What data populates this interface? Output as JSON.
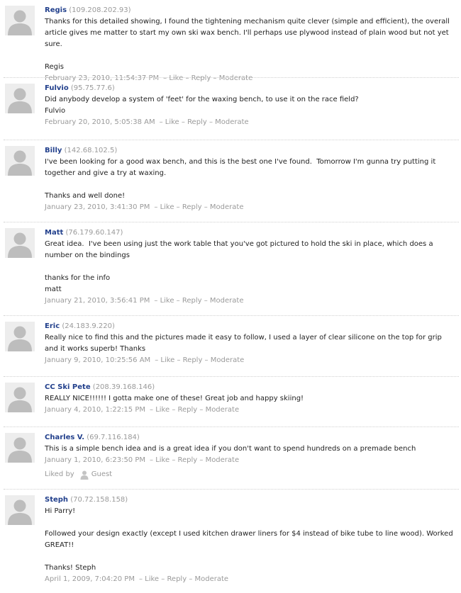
{
  "actions": {
    "like": "Like",
    "reply": "Reply",
    "moderate": "Moderate"
  },
  "liked_by": {
    "label": "Liked by",
    "user": "Guest"
  },
  "comments": [
    {
      "author": "Regis",
      "ip": "(109.208.202.93)",
      "text": "Thanks for this detailed showing, I found the tightening mechanism quite clever (simple and efficient), the overall article gives me matter to start my own ski wax bench. I'll perhaps use plywood instead of plain wood but not yet sure.\n\nRegis",
      "date": "February 23, 2010, 11:54:37 PM"
    },
    {
      "author": "Fulvio",
      "ip": "(95.75.77.6)",
      "text": "Did anybody develop a system of 'feet' for the waxing bench, to use it on the race field?\nFulvio",
      "date": "February 20, 2010, 5:05:38 AM"
    },
    {
      "author": "Billy",
      "ip": "(142.68.102.5)",
      "text": "I've been looking for a good wax bench, and this is the best one I've found.  Tomorrow I'm gunna try putting it together and give a try at waxing.\n\nThanks and well done!",
      "date": "January 23, 2010, 3:41:30 PM"
    },
    {
      "author": "Matt",
      "ip": "(76.179.60.147)",
      "text": "Great idea.  I've been using just the work table that you've got pictured to hold the ski in place, which does a number on the bindings\n\nthanks for the info\nmatt",
      "date": "January 21, 2010, 3:56:41 PM"
    },
    {
      "author": "Eric",
      "ip": "(24.183.9.220)",
      "text": "Really nice to find this and the pictures made it easy to follow, I used a layer of clear silicone on the top for grip and it works superb! Thanks",
      "date": "January 9, 2010, 10:25:56 AM"
    },
    {
      "author": "CC Ski Pete",
      "ip": "(208.39.168.146)",
      "text": "REALLY NICE!!!!!! I gotta make one of these! Great job and happy skiing!",
      "date": "January 4, 2010, 1:22:15 PM"
    },
    {
      "author": "Charles V.",
      "ip": "(69.7.116.184)",
      "text": "This is a simple bench idea and is a great idea if you don't want to spend hundreds on a premade bench",
      "date": "January 1, 2010, 6:23:50 PM",
      "liked": true
    },
    {
      "author": "Steph",
      "ip": "(70.72.158.158)",
      "text": "Hi Parry!\n\nFollowed your design exactly (except I used kitchen drawer liners for $4 instead of bike tube to line wood). Worked GREAT!!\n\nThanks! Steph",
      "date": "April 1, 2009, 7:04:20 PM"
    }
  ]
}
